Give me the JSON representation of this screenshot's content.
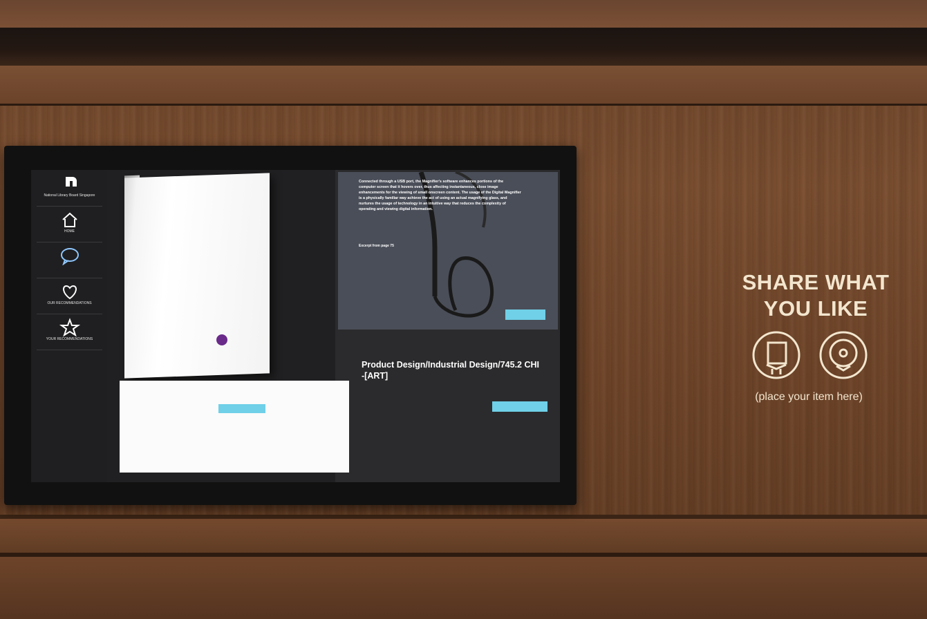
{
  "sidebar": {
    "items": [
      {
        "label": "National Library Board Singapore",
        "icon": "nlb-logo-icon"
      },
      {
        "label": "HOME",
        "icon": "home-icon"
      },
      {
        "label": "",
        "icon": "chat-icon"
      },
      {
        "label": "OUR RECOMMENDATIONS",
        "icon": "heart-icon"
      },
      {
        "label": "YOUR RECOMMENDATIONS",
        "icon": "star-icon"
      }
    ]
  },
  "product": {
    "panel_button_label": "",
    "read_more_label": ""
  },
  "excerpt": {
    "text": "Connected through a USB port, the Magnifier's software enhances portions of the computer screen that it hovers over, thus affecting instantaneous, close image enhancements for the viewing of small onscreen content. The usage of the Digital Magnifier is a physically familiar way achieve the act of using an actual magnifying glass, and nurtures the usage of technology in an intuitive way that reduces the complexity of operating and viewing digital information.",
    "page_ref": "Excerpt from page 75",
    "button_label": ""
  },
  "details": {
    "title": "Product Design/Industrial Design/745.2 CHI -[ART]"
  },
  "share": {
    "title_line1": "SHARE WHAT",
    "title_line2": "YOU LIKE",
    "caption": "(place your item here)",
    "icons": [
      "book-icon",
      "disc-icon"
    ]
  },
  "colors": {
    "accent": "#6fd0e8",
    "share_text": "#f3e6cf",
    "screen_bg": "#2b2b2d"
  }
}
